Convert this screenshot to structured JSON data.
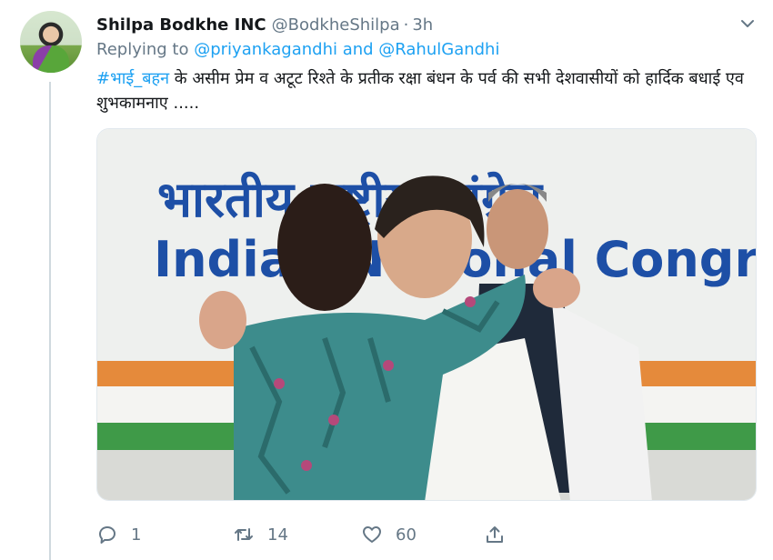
{
  "tweet": {
    "display_name": "Shilpa Bodkhe INC",
    "handle": "@BodkheShilpa",
    "separator": "·",
    "time": "3h",
    "replying_to_prefix": "Replying to",
    "replying_to_users": "@priyankagandhi and @RahulGandhi",
    "hashtag": "#भाई_बहन",
    "text": " के असीम प्रेम व अटूट रिश्ते के प्रतीक रक्षा बंधन के पर्व की सभी देशवासीयों को हार्दिक बधाई एव शुभकामनाए .....",
    "media": {
      "banner_hindi": "भारतीय राष्ट्रीय कांग्रेस",
      "banner_english": "Indian National Congress"
    }
  },
  "actions": {
    "reply_count": "1",
    "retweet_count": "14",
    "like_count": "60"
  },
  "colors": {
    "link": "#1da1f2",
    "muted": "#657786",
    "text": "#14171a"
  },
  "icons": [
    "chevron-down-icon",
    "reply-icon",
    "retweet-icon",
    "heart-icon",
    "share-icon"
  ]
}
